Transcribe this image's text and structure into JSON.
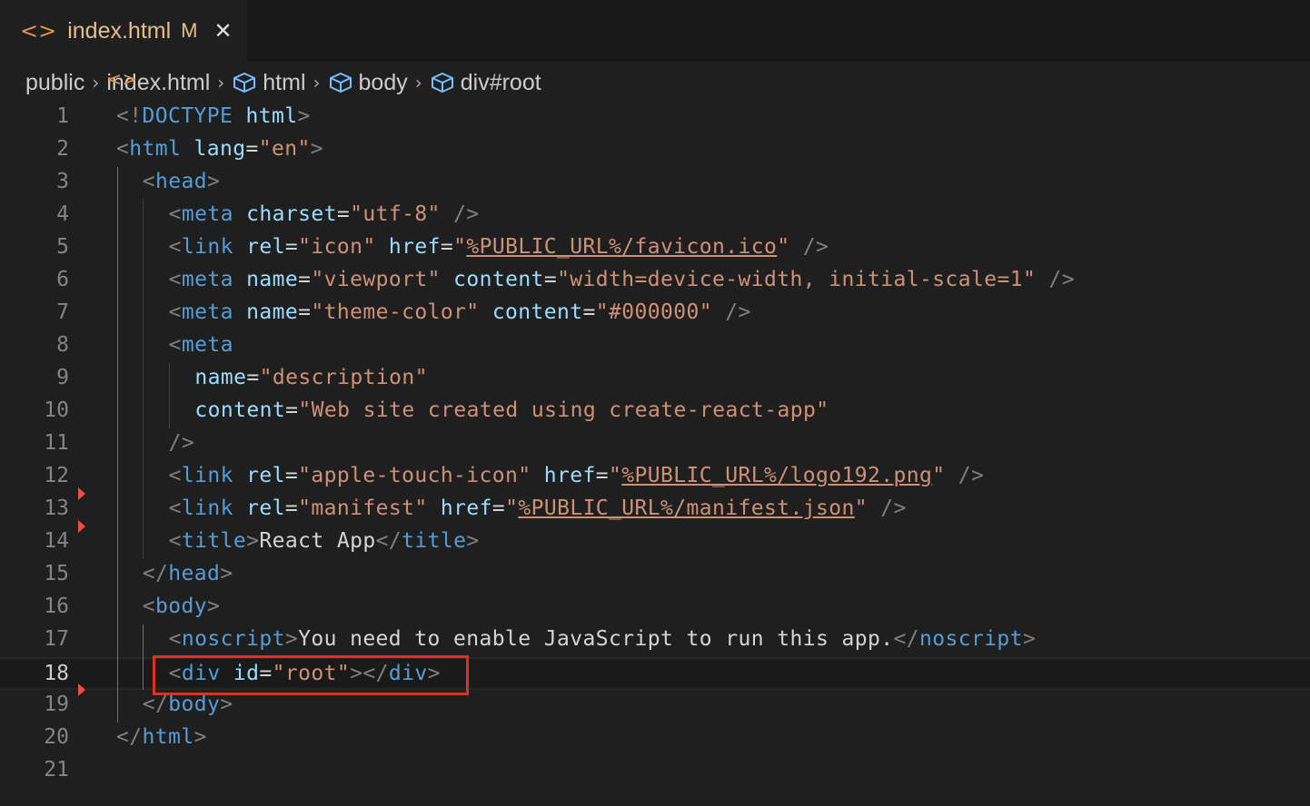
{
  "tab": {
    "icon": "<>",
    "title": "index.html",
    "modified": "M",
    "close": "✕"
  },
  "breadcrumb": {
    "items": [
      {
        "label": "public",
        "icon": ""
      },
      {
        "label": "index.html",
        "icon": "code-icon"
      },
      {
        "label": "html",
        "icon": "symbol-element-icon"
      },
      {
        "label": "body",
        "icon": "symbol-element-icon"
      },
      {
        "label": "div#root",
        "icon": "symbol-element-icon"
      }
    ]
  },
  "editor": {
    "current_line": 18,
    "line_numbers": [
      "1",
      "2",
      "3",
      "4",
      "5",
      "6",
      "7",
      "8",
      "9",
      "10",
      "11",
      "12",
      "13",
      "14",
      "15",
      "16",
      "17",
      "18",
      "19",
      "20",
      "21"
    ],
    "lines": [
      "<!DOCTYPE html>",
      "<html lang=\"en\">",
      "<head>",
      "<meta charset=\"utf-8\" />",
      "<link rel=\"icon\" href=\"%PUBLIC_URL%/favicon.ico\" />",
      "<meta name=\"viewport\" content=\"width=device-width, initial-scale=1\" />",
      "<meta name=\"theme-color\" content=\"#000000\" />",
      "<meta",
      "name=\"description\"",
      "content=\"Web site created using create-react-app\"",
      "/>",
      "<link rel=\"apple-touch-icon\" href=\"%PUBLIC_URL%/logo192.png\" />",
      "<link rel=\"manifest\" href=\"%PUBLIC_URL%/manifest.json\" />",
      "<title>React App</title>",
      "</head>",
      "<body>",
      "<noscript>You need to enable JavaScript to run this app.</noscript>",
      "<div id=\"root\"></div>",
      "</body>",
      "</html>",
      ""
    ]
  },
  "colors": {
    "background": "#1f1f1f",
    "tag": "#569cd6",
    "attribute": "#9cdcfe",
    "string": "#ce9178",
    "punctuation": "#808080",
    "text": "#d4d4d4",
    "modified": "#e2c08d",
    "highlight_box": "#e0301e",
    "gutter_marker": "#f14c4c"
  }
}
